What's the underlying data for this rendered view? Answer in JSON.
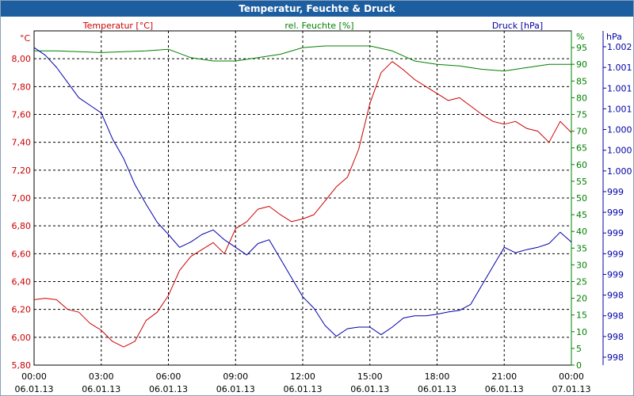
{
  "window": {
    "title": "Temperatur, Feuchte & Druck"
  },
  "colors": {
    "temperature": "#cc0000",
    "humidity": "#008000",
    "pressure": "#0000aa",
    "grid": "#000000",
    "title_bg": "#1d5ea0"
  },
  "chart_data": {
    "type": "line",
    "title": "Temperatur, Feuchte & Druck",
    "grid": true,
    "x": {
      "range": [
        "06.01.13 00:00",
        "07.01.13 00:00"
      ],
      "ticks": [
        {
          "time": "00:00",
          "date": "06.01.13"
        },
        {
          "time": "03:00",
          "date": "06.01.13"
        },
        {
          "time": "06:00",
          "date": "06.01.13"
        },
        {
          "time": "09:00",
          "date": "06.01.13"
        },
        {
          "time": "12:00",
          "date": "06.01.13"
        },
        {
          "time": "15:00",
          "date": "06.01.13"
        },
        {
          "time": "18:00",
          "date": "06.01.13"
        },
        {
          "time": "21:00",
          "date": "06.01.13"
        },
        {
          "time": "00:00",
          "date": "07.01.13"
        }
      ]
    },
    "axes": {
      "temperature": {
        "label": "Temperatur [°C]",
        "unit": "°C",
        "position": "left",
        "ylim": [
          5.8,
          8.2
        ],
        "ticks": [
          "8,00",
          "7,80",
          "7,60",
          "7,40",
          "7,20",
          "7,00",
          "6,80",
          "6,60",
          "6,40",
          "6,20",
          "6,00",
          "5,80"
        ]
      },
      "humidity": {
        "label": "rel. Feuchte [%]",
        "unit": "%",
        "position": "right-inner",
        "ylim": [
          0,
          100
        ],
        "ticks": [
          "95",
          "90",
          "85",
          "80",
          "75",
          "70",
          "65",
          "60",
          "55",
          "50",
          "45",
          "40",
          "35",
          "30",
          "25",
          "20",
          "15",
          "10",
          "5",
          "0"
        ]
      },
      "pressure": {
        "label": "Druck [hPa]",
        "unit": "hPa",
        "position": "right-outer",
        "ylim": [
          997.8,
          1002.2
        ],
        "ticks": [
          "1.002",
          "1.001",
          "1.001",
          "1.001",
          "1.000",
          "1.000",
          "1.000",
          "999",
          "999",
          "999",
          "999",
          "999",
          "998",
          "998",
          "998",
          "998"
        ]
      }
    },
    "series": [
      {
        "name": "Temperatur [°C]",
        "axis": "temperature",
        "hours": [
          0,
          0.5,
          1,
          1.5,
          2,
          2.5,
          3,
          3.5,
          4,
          4.5,
          5,
          5.5,
          6,
          6.5,
          7,
          7.5,
          8,
          8.5,
          9,
          9.5,
          10,
          10.5,
          11,
          11.5,
          12,
          12.5,
          13,
          13.5,
          14,
          14.5,
          15,
          15.5,
          16,
          16.5,
          17,
          17.5,
          18,
          18.5,
          19,
          19.5,
          20,
          20.5,
          21,
          21.5,
          22,
          22.5,
          23,
          23.5,
          24
        ],
        "values": [
          6.27,
          6.28,
          6.27,
          6.2,
          6.18,
          6.1,
          6.05,
          5.97,
          5.93,
          5.97,
          6.12,
          6.18,
          6.3,
          6.48,
          6.58,
          6.63,
          6.68,
          6.6,
          6.78,
          6.83,
          6.92,
          6.94,
          6.88,
          6.83,
          6.85,
          6.88,
          6.98,
          7.08,
          7.15,
          7.35,
          7.68,
          7.9,
          7.98,
          7.92,
          7.85,
          7.8,
          7.75,
          7.7,
          7.72,
          7.66,
          7.6,
          7.55,
          7.53,
          7.55,
          7.5,
          7.48,
          7.4,
          7.55,
          7.47
        ]
      },
      {
        "name": "rel. Feuchte [%]",
        "axis": "humidity",
        "hours": [
          0,
          1,
          2,
          3,
          4,
          5,
          6,
          7,
          8,
          9,
          10,
          11,
          12,
          13,
          14,
          15,
          16,
          17,
          18,
          19,
          20,
          21,
          22,
          23,
          24
        ],
        "values": [
          94.0,
          94.0,
          93.8,
          93.5,
          93.8,
          94.0,
          94.5,
          92.0,
          91.0,
          91.0,
          92.0,
          93.0,
          95.0,
          95.5,
          95.5,
          95.5,
          94.0,
          91.0,
          90.0,
          89.5,
          88.5,
          88.0,
          89.0,
          90.0,
          90.0
        ]
      },
      {
        "name": "Druck [hPa]",
        "axis": "pressure",
        "hours": [
          0,
          0.5,
          1,
          1.5,
          2,
          2.5,
          3,
          3.5,
          4,
          4.5,
          5,
          5.5,
          6,
          6.5,
          7,
          7.5,
          8,
          8.5,
          9,
          9.5,
          10,
          10.5,
          11,
          11.5,
          12,
          12.5,
          13,
          13.5,
          14,
          14.5,
          15,
          15.5,
          16,
          16.5,
          17,
          17.5,
          18,
          18.5,
          19,
          19.5,
          20,
          20.5,
          21,
          21.5,
          22,
          22.5,
          23,
          23.5,
          24
        ],
        "values": [
          1001.98,
          1001.88,
          1001.72,
          1001.52,
          1001.32,
          1001.22,
          1001.12,
          1000.78,
          1000.52,
          1000.18,
          999.92,
          999.68,
          999.52,
          999.35,
          999.42,
          999.52,
          999.58,
          999.45,
          999.35,
          999.25,
          999.4,
          999.45,
          999.2,
          998.95,
          998.7,
          998.55,
          998.32,
          998.18,
          998.28,
          998.3,
          998.3,
          998.2,
          998.3,
          998.42,
          998.45,
          998.45,
          998.47,
          998.5,
          998.52,
          998.6,
          998.85,
          999.1,
          999.35,
          999.28,
          999.32,
          999.35,
          999.4,
          999.55,
          999.42
        ]
      }
    ]
  }
}
